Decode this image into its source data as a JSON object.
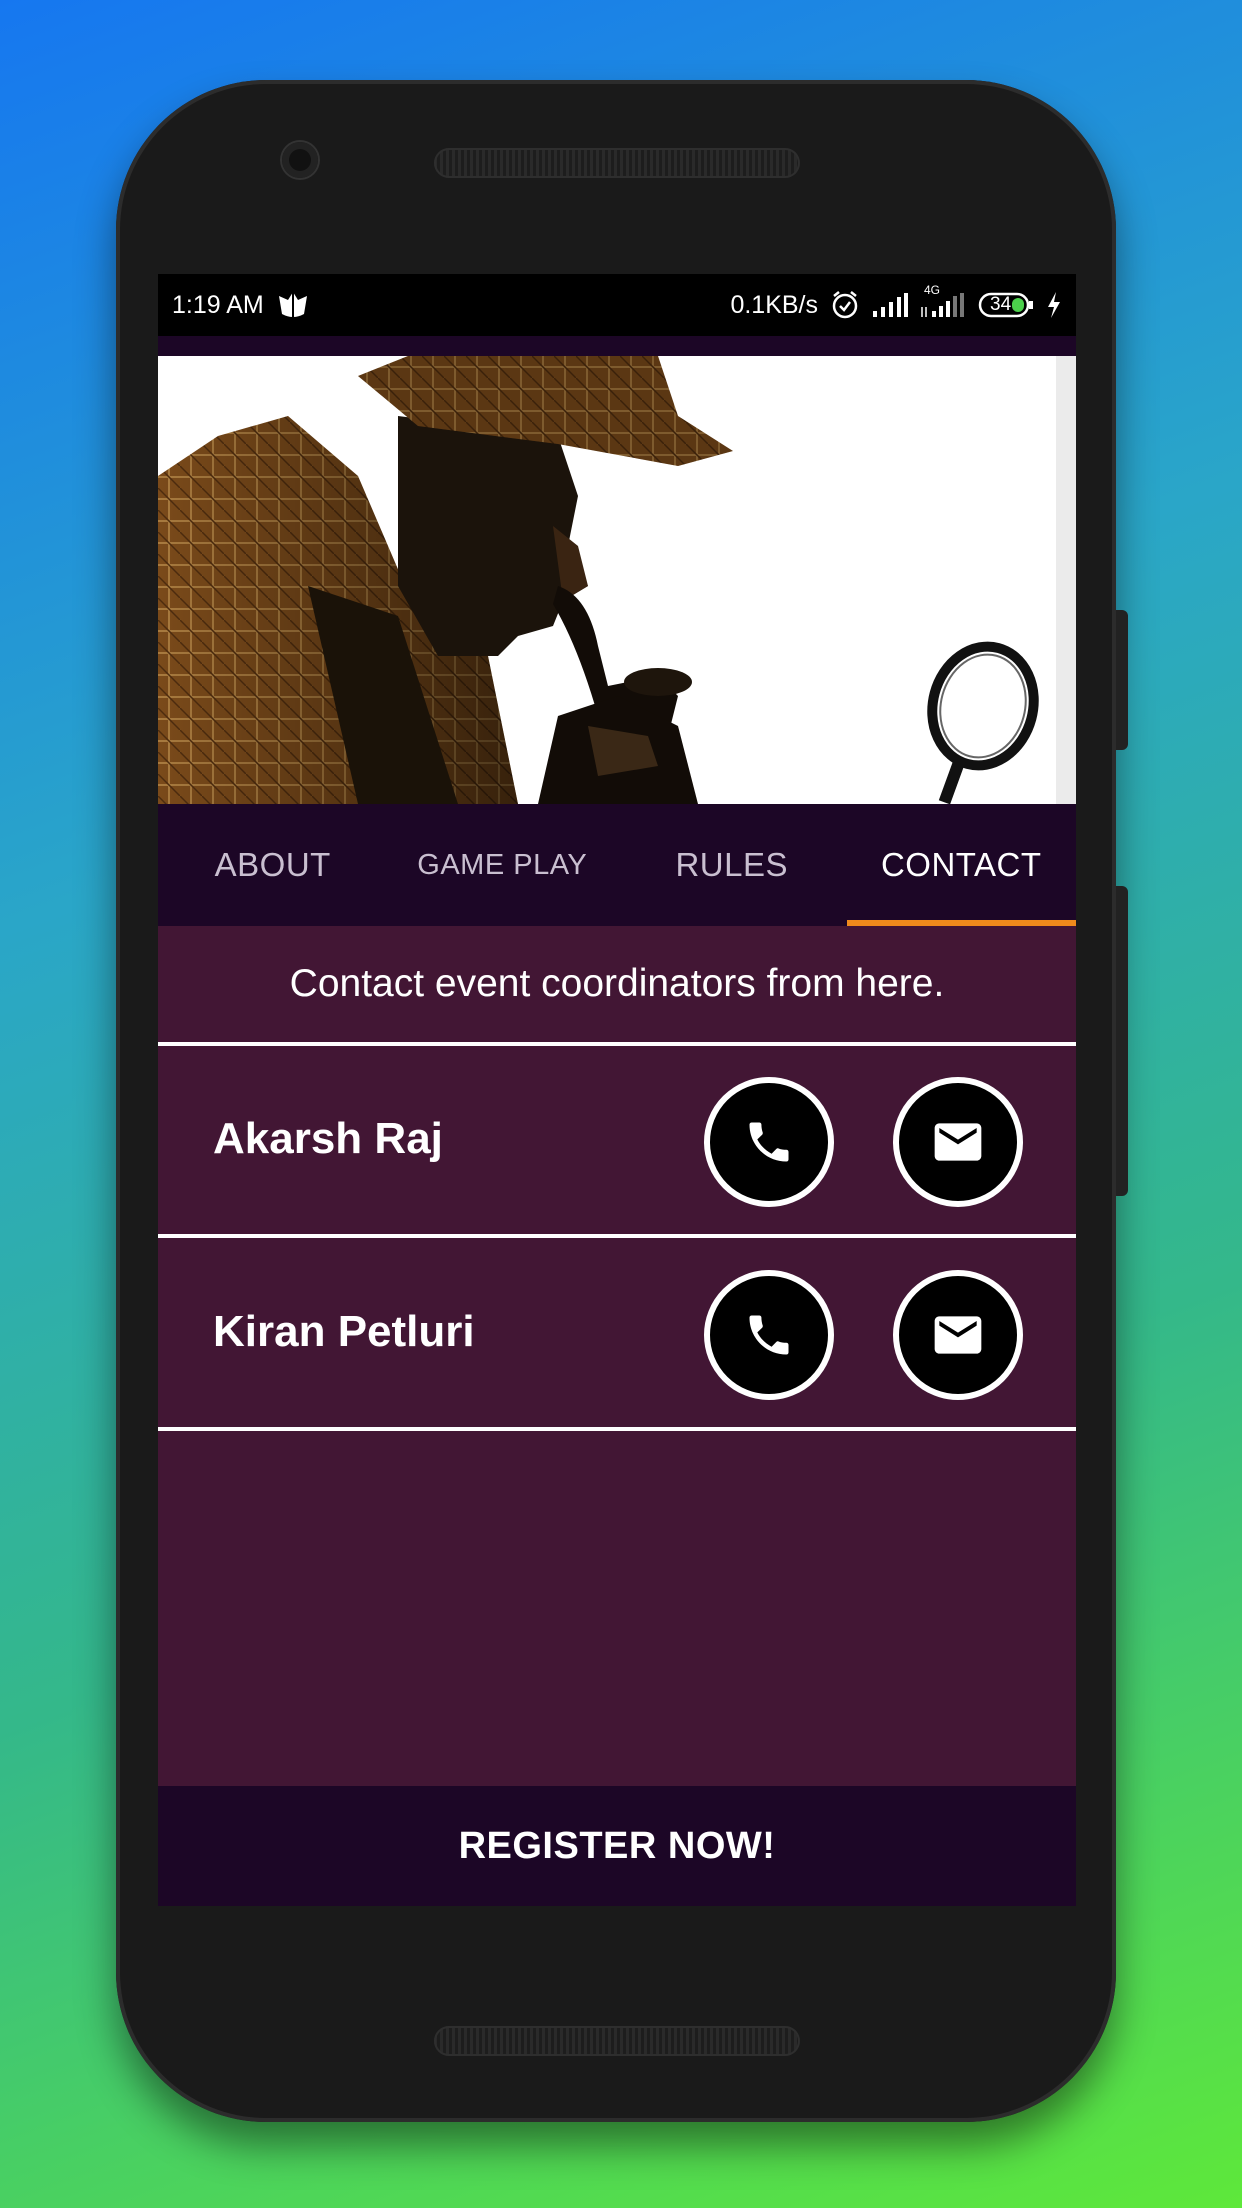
{
  "status_bar": {
    "time": "1:19 AM",
    "speed": "0.1KB/s",
    "network_label": "4G",
    "battery_level": "34",
    "icons": [
      "shield-app-icon",
      "alarm-icon",
      "signal-icon",
      "signal-4g-icon",
      "battery-icon",
      "charging-icon"
    ]
  },
  "hero": {
    "image": "detective-with-pipe-and-magnifying-glass"
  },
  "tabs": [
    {
      "label": "ABOUT",
      "active": false
    },
    {
      "label": "GAME PLAY",
      "active": false
    },
    {
      "label": "RULES",
      "active": false
    },
    {
      "label": "CONTACT",
      "active": true
    }
  ],
  "intro_text": "Contact event coordinators from here.",
  "contacts": [
    {
      "name": "Akarsh Raj",
      "actions": [
        "phone-icon",
        "email-icon"
      ]
    },
    {
      "name": "Kiran Petluri",
      "actions": [
        "phone-icon",
        "email-icon"
      ]
    }
  ],
  "register_label": "REGISTER NOW!",
  "colors": {
    "screen_background": "#421634",
    "header_background": "#1c0626",
    "tab_indicator": "#ef8a1c",
    "text": "#ffffff"
  }
}
